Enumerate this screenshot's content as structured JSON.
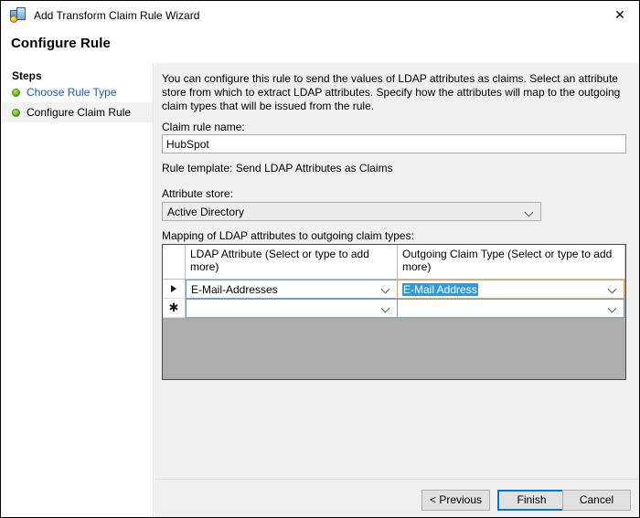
{
  "window": {
    "title": "Add Transform Claim Rule Wizard",
    "icon": "wizard-icon",
    "close_label": "✕"
  },
  "heading": "Configure Rule",
  "sidebar": {
    "title": "Steps",
    "items": [
      {
        "label": "Choose Rule Type",
        "state": "completed-link"
      },
      {
        "label": "Configure Claim Rule",
        "state": "current"
      }
    ]
  },
  "main": {
    "description": "You can configure this rule to send the values of LDAP attributes as claims. Select an attribute store from which to extract LDAP attributes. Specify how the attributes will map to the outgoing claim types that will be issued from the rule.",
    "rule_name_label": "Claim rule name:",
    "rule_name_value": "HubSpot",
    "rule_name_placeholder": "",
    "rule_template_text": "Rule template: Send LDAP Attributes as Claims",
    "attribute_store_label": "Attribute store:",
    "attribute_store_value": "Active Directory",
    "mapping_label": "Mapping of LDAP attributes to outgoing claim types:",
    "grid": {
      "columns": [
        "LDAP Attribute (Select or type to add more)",
        "Outgoing Claim Type (Select or type to add more)"
      ],
      "rows": [
        {
          "marker": "current-row-arrow",
          "ldap_attribute": "E-Mail-Addresses",
          "outgoing_claim_type": "E-Mail Address",
          "claim_selected": true
        },
        {
          "marker": "new-row-asterisk",
          "ldap_attribute": "",
          "outgoing_claim_type": "",
          "claim_selected": false
        }
      ]
    }
  },
  "footer": {
    "previous_label": "< Previous",
    "finish_label": "Finish",
    "cancel_label": "Cancel"
  },
  "colors": {
    "accent": "#0078d7",
    "selection": "#3399dd",
    "link": "#1a54c4",
    "step_bullet": "#62b320",
    "grid_empty": "#adadad"
  }
}
